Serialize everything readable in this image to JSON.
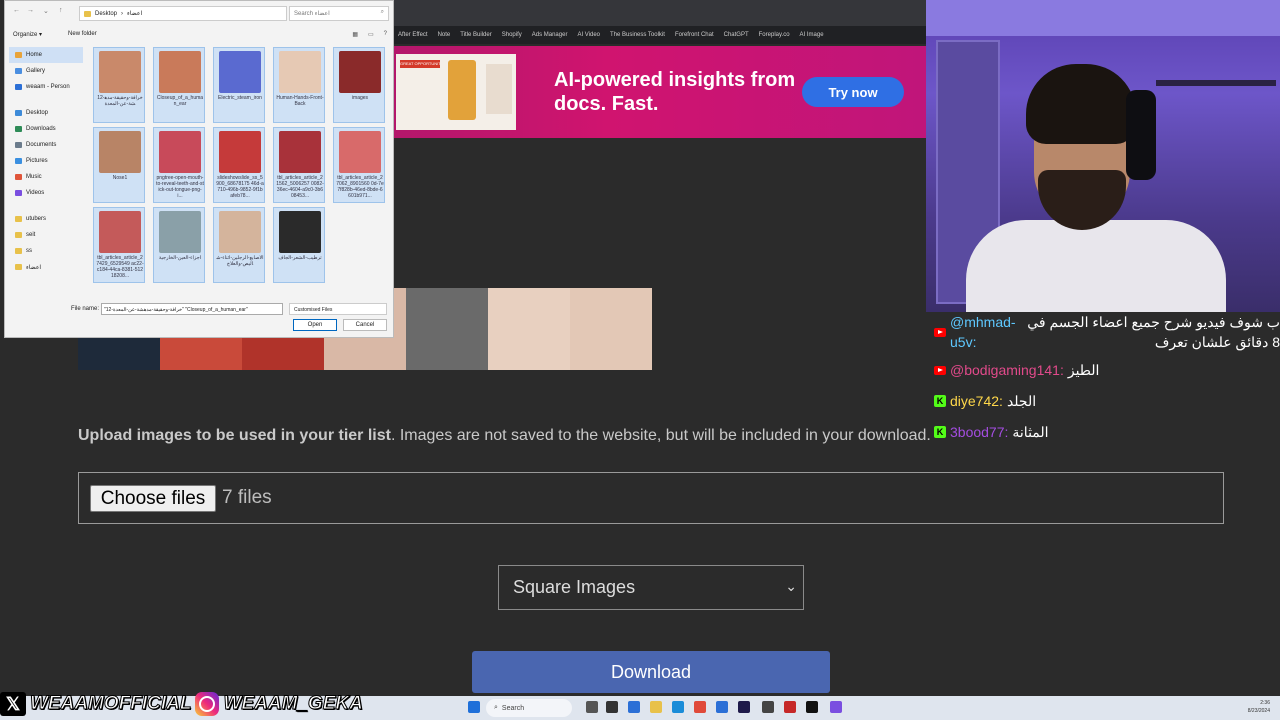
{
  "browser": {
    "bookmarks": [
      "After Effect",
      "Note",
      "Title Builder",
      "Shopify",
      "Ads Manager",
      "AI Video",
      "The Business Toolkit",
      "Forefront Chat",
      "ChatGPT",
      "Foreplay.co",
      "AI Image"
    ]
  },
  "ad": {
    "headline": "AI-powered insights from docs. Fast.",
    "cta": "Try now",
    "mock_heading": "GREAT OPPORTUNITY"
  },
  "page": {
    "upload_bold": "Upload images to be used in your tier list",
    "upload_rest": ". Images are not saved to the website, but will be included in your download.",
    "choose_files": "Choose files",
    "file_count": "7 files",
    "select_value": "Square Images",
    "download": "Download"
  },
  "dialog": {
    "path_root": "Desktop",
    "path_folder": "اعضاء",
    "search_placeholder": "Search اعضاء",
    "organize": "Organize ▾",
    "new_folder": "New folder",
    "sidebar": [
      {
        "label": "Home",
        "color": "#e8a33a"
      },
      {
        "label": "Gallery",
        "color": "#4a8ee0"
      },
      {
        "label": "weaam - Person",
        "color": "#2b6fd6"
      },
      {
        "label": "Desktop",
        "color": "#3d8ad8"
      },
      {
        "label": "Downloads",
        "color": "#2e8b57"
      },
      {
        "label": "Documents",
        "color": "#6b7b8c"
      },
      {
        "label": "Pictures",
        "color": "#3a8fe0"
      },
      {
        "label": "Music",
        "color": "#e0553a"
      },
      {
        "label": "Videos",
        "color": "#7a4ee0"
      },
      {
        "label": "utubers",
        "color": "#e8c14a"
      },
      {
        "label": "seit",
        "color": "#e8c14a"
      },
      {
        "label": "ss",
        "color": "#e8c14a"
      },
      {
        "label": "اعضاء",
        "color": "#e8c14a"
      }
    ],
    "files": [
      {
        "label": "12-خرافة-وحقيقة-مدهشة-عن-المعدة",
        "color": "#c9896a"
      },
      {
        "label": "Closeup_of_a_human_ear",
        "color": "#c97a5a"
      },
      {
        "label": "Electric_steam_iron",
        "color": "#5a6ad0"
      },
      {
        "label": "Human-Hands-Front-Back",
        "color": "#e6c9b4"
      },
      {
        "label": "images",
        "color": "#8a2a2a"
      },
      {
        "label": "Nose1",
        "color": "#b88466"
      },
      {
        "label": "pngtree-open-mouth-to-reveal-teeth-and-stick-out-tongue-png-i...",
        "color": "#c84a5a"
      },
      {
        "label": "slideshowslide_ss_5900_68678175 46d-a710-496b-9852-9f1bafeb78...",
        "color": "#c53a3a"
      },
      {
        "label": "tbl_articles_article_21562_5006257 0082-36ec-4604-a9c0-3b608453...",
        "color": "#a8323a"
      },
      {
        "label": "tbl_articles_article_27062_8901560 0d-7e7f828b-46ed-8bde-6601b971...",
        "color": "#d86a6a"
      },
      {
        "label": "tbl_articles_article_27429_6529549 ac22-c184-44ca-8381-51218208...",
        "color": "#c45a5a"
      },
      {
        "label": "اجزاء-العين-الخارجية",
        "color": "#8aa0a8"
      },
      {
        "label": "الاصابع-الرجلين-اثناء-شاليص-والعلاج",
        "color": "#d4b49c"
      },
      {
        "label": "ترطيب-الشعر-الجاف",
        "color": "#2a2a2a"
      }
    ],
    "file_name_label": "File name:",
    "file_name_value": "\"12-خرافة-وحقيقة-مدهشة-عن-المعدة\" \"Closeup_of_a_human_ear\"",
    "file_type": "Customised Files",
    "open": "Open",
    "cancel": "Cancel"
  },
  "strip_colors": [
    "#1e2a3a",
    "#c94a3a",
    "#b0332a",
    "#d9b8a6",
    "#6a6a6a",
    "#e8d0c0"
  ],
  "chat": [
    {
      "platform": "youtube",
      "user": "@mhmad-u5v:",
      "message": "ب شوف فيديو شرح جميع اعضاء الجسم في 8 دقائق علشان تعرف",
      "cls": "user1",
      "wrap": true
    },
    {
      "platform": "youtube",
      "user": "@bodigaming141:",
      "message": "الطيز",
      "cls": "user2"
    },
    {
      "platform": "kick",
      "user": "diye742:",
      "message": "الجلد",
      "cls": "user3"
    },
    {
      "platform": "kick",
      "user": "3bood77:",
      "message": "المثانة",
      "cls": "user4"
    }
  ],
  "social": {
    "x_handle": "WEAAMOFFICIAL",
    "ig_handle": "WEAAM_GEKA"
  },
  "taskbar": {
    "search": "Search",
    "time": "2:36",
    "date": "8/23/2024"
  }
}
